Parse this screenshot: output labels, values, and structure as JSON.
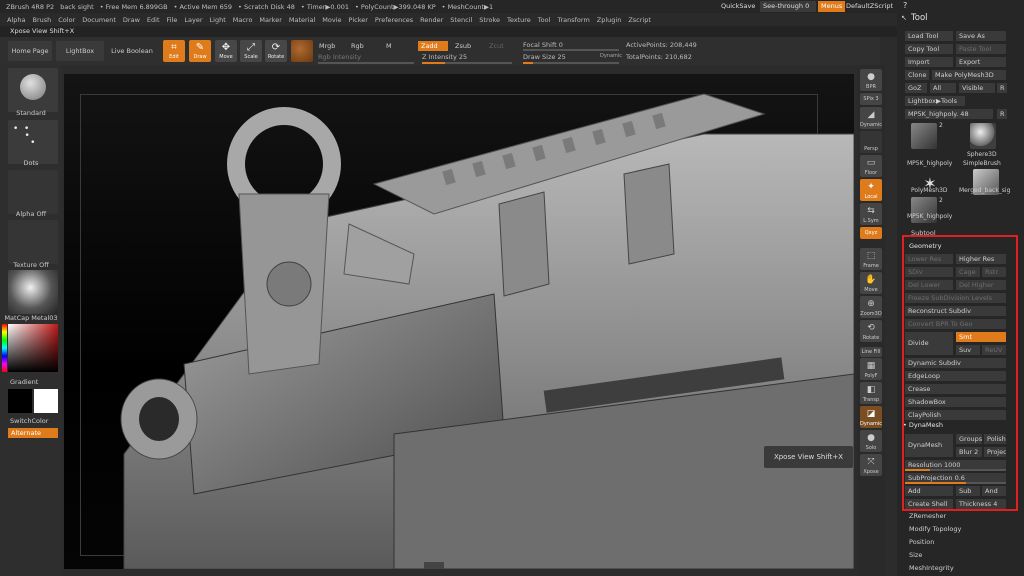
{
  "title_bar": {
    "app_version": "ZBrush 4R8 P2",
    "doc_name": "back sight",
    "free_mem": "• Free Mem 6.899GB",
    "active_mem": "• Active Mem 659",
    "scratch_disk": "• Scratch Disk 48",
    "timer": "• Timer▶0.001",
    "polycount": "• PolyCount▶399.048 KP",
    "meshcount": "• MeshCount▶1",
    "quicksave": "QuickSave",
    "see_through": "See-through  0",
    "menus": "Menus",
    "default_script": "DefaultZScript"
  },
  "menu_bar": [
    "Alpha",
    "Brush",
    "Color",
    "Document",
    "Draw",
    "Edit",
    "File",
    "Layer",
    "Light",
    "Macro",
    "Marker",
    "Material",
    "Movie",
    "Picker",
    "Preferences",
    "Render",
    "Stencil",
    "Stroke",
    "Texture",
    "Tool",
    "Transform",
    "Zplugin",
    "Zscript"
  ],
  "xpose_bar": {
    "label": "Xpose View Shift+X"
  },
  "top_shelf": {
    "home_page": "Home Page",
    "lightbox": "LightBox",
    "live_boolean": "Live Boolean",
    "edit": "Edit",
    "draw": "Draw",
    "move": "Move",
    "scale": "Scale",
    "rotate": "Rotate",
    "mrgb": "Mrgb",
    "rgb": "Rgb",
    "m": "M",
    "rgb_intensity": "Rgb Intensity",
    "zadd": "Zadd",
    "zsub": "Zsub",
    "zcut": "Zcut",
    "z_intensity": "Z Intensity 25",
    "z_intensity_value": 25,
    "focal_shift": "Focal Shift 0",
    "draw_size": "Draw Size 25",
    "dynamic": "Dynamic",
    "active_points": "ActivePoints: 208,449",
    "total_points": "TotalPoints: 210,682"
  },
  "left_shelf": {
    "brush": "Standard",
    "stroke": "Dots",
    "alpha": "Alpha Off",
    "texture": "Texture Off",
    "material": "MatCap Metal03",
    "gradient": "Gradient",
    "switch_color": "SwitchColor",
    "alternate": "Alternate"
  },
  "right_dock": [
    {
      "name": "bpr",
      "label": "BPR"
    },
    {
      "name": "spix",
      "label": "SPix 3"
    },
    {
      "name": "dynamic",
      "label": "Dynamic"
    },
    {
      "name": "persp",
      "label": "Persp"
    },
    {
      "name": "floor",
      "label": "Floor"
    },
    {
      "name": "local",
      "label": "Local"
    },
    {
      "name": "lsym",
      "label": "L.Sym"
    },
    {
      "name": "qxyz",
      "label": "Qxyz"
    },
    {
      "name": "frame",
      "label": "Frame"
    },
    {
      "name": "move",
      "label": "Move"
    },
    {
      "name": "zoom3d",
      "label": "Zoom3D"
    },
    {
      "name": "rotate",
      "label": "Rotate"
    },
    {
      "name": "line_fill",
      "label": "Line Fill"
    },
    {
      "name": "polyf",
      "label": "PolyF"
    },
    {
      "name": "transp",
      "label": "Transp"
    },
    {
      "name": "dynamic2",
      "label": "Dynamic"
    },
    {
      "name": "solo",
      "label": "Solo"
    },
    {
      "name": "xpose",
      "label": "Xpose"
    }
  ],
  "tool_panel": {
    "title": "Tool",
    "load_tool": "Load Tool",
    "save_as": "Save As",
    "copy_tool": "Copy Tool",
    "paste_tool": "Paste Tool",
    "import": "Import",
    "export": "Export",
    "clone": "Clone",
    "make_polymesh": "Make PolyMesh3D",
    "goz": "GoZ",
    "all": "All",
    "visible": "Visible",
    "r": "R",
    "lightbox_tools": "Lightbox▶Tools",
    "current_tool": "MP5K_highpoly. 48",
    "thumbs": [
      {
        "label": "MP5K_highpoly",
        "count": "2"
      },
      {
        "label": "Sphere3D",
        "count": ""
      },
      {
        "label": "SimpleBrush",
        "count": ""
      },
      {
        "label": "PolyMesh3D",
        "count": ""
      },
      {
        "label": "Merged_back_sig",
        "count": ""
      },
      {
        "label": "MP5K_highpoly",
        "count": "2"
      }
    ],
    "subtool": "Subtool",
    "geometry": "Geometry",
    "lower_res": "Lower Res",
    "higher_res": "Higher Res",
    "sdiv": "SDiv",
    "cage": "Cage",
    "rstr": "Rstr",
    "del_lower": "Del Lower",
    "del_higher": "Del Higher",
    "freeze_subdiv": "Freeze SubDivision Levels",
    "reconstruct_subdiv": "Reconstruct Subdiv",
    "convert_bpr": "Convert BPR To Geo",
    "divide": "Divide",
    "smt": "Smt",
    "suv": "Suv",
    "reuv": "ReUV",
    "dynamic_subdiv": "Dynamic Subdiv",
    "edgeloop": "EdgeLoop",
    "crease": "Crease",
    "shadowbox": "ShadowBox",
    "claypolish": "ClayPolish",
    "dynamesh_section": "DynaMesh",
    "dynamesh_btn": "DynaMesh",
    "groups": "Groups",
    "polish": "Polish",
    "blur": "Blur 2",
    "project": "Project",
    "resolution": "Resolution 1000",
    "resolution_value": 1000,
    "subprojection": "SubProjection 0.6",
    "subprojection_value": 0.6,
    "add": "Add",
    "sub": "Sub",
    "and": "And",
    "create_shell": "Create Shell",
    "thickness": "Thickness 4",
    "zremesher": "ZRemesher",
    "modify_topology": "Modify Topology",
    "position": "Position",
    "size": "Size",
    "meshintegrity": "MeshIntegrity"
  },
  "viewport": {
    "tooltip": "Xpose View  Shift+X"
  },
  "colors": {
    "accent": "#e07b1b",
    "highlight_box": "#e02020",
    "panel": "#262626"
  }
}
